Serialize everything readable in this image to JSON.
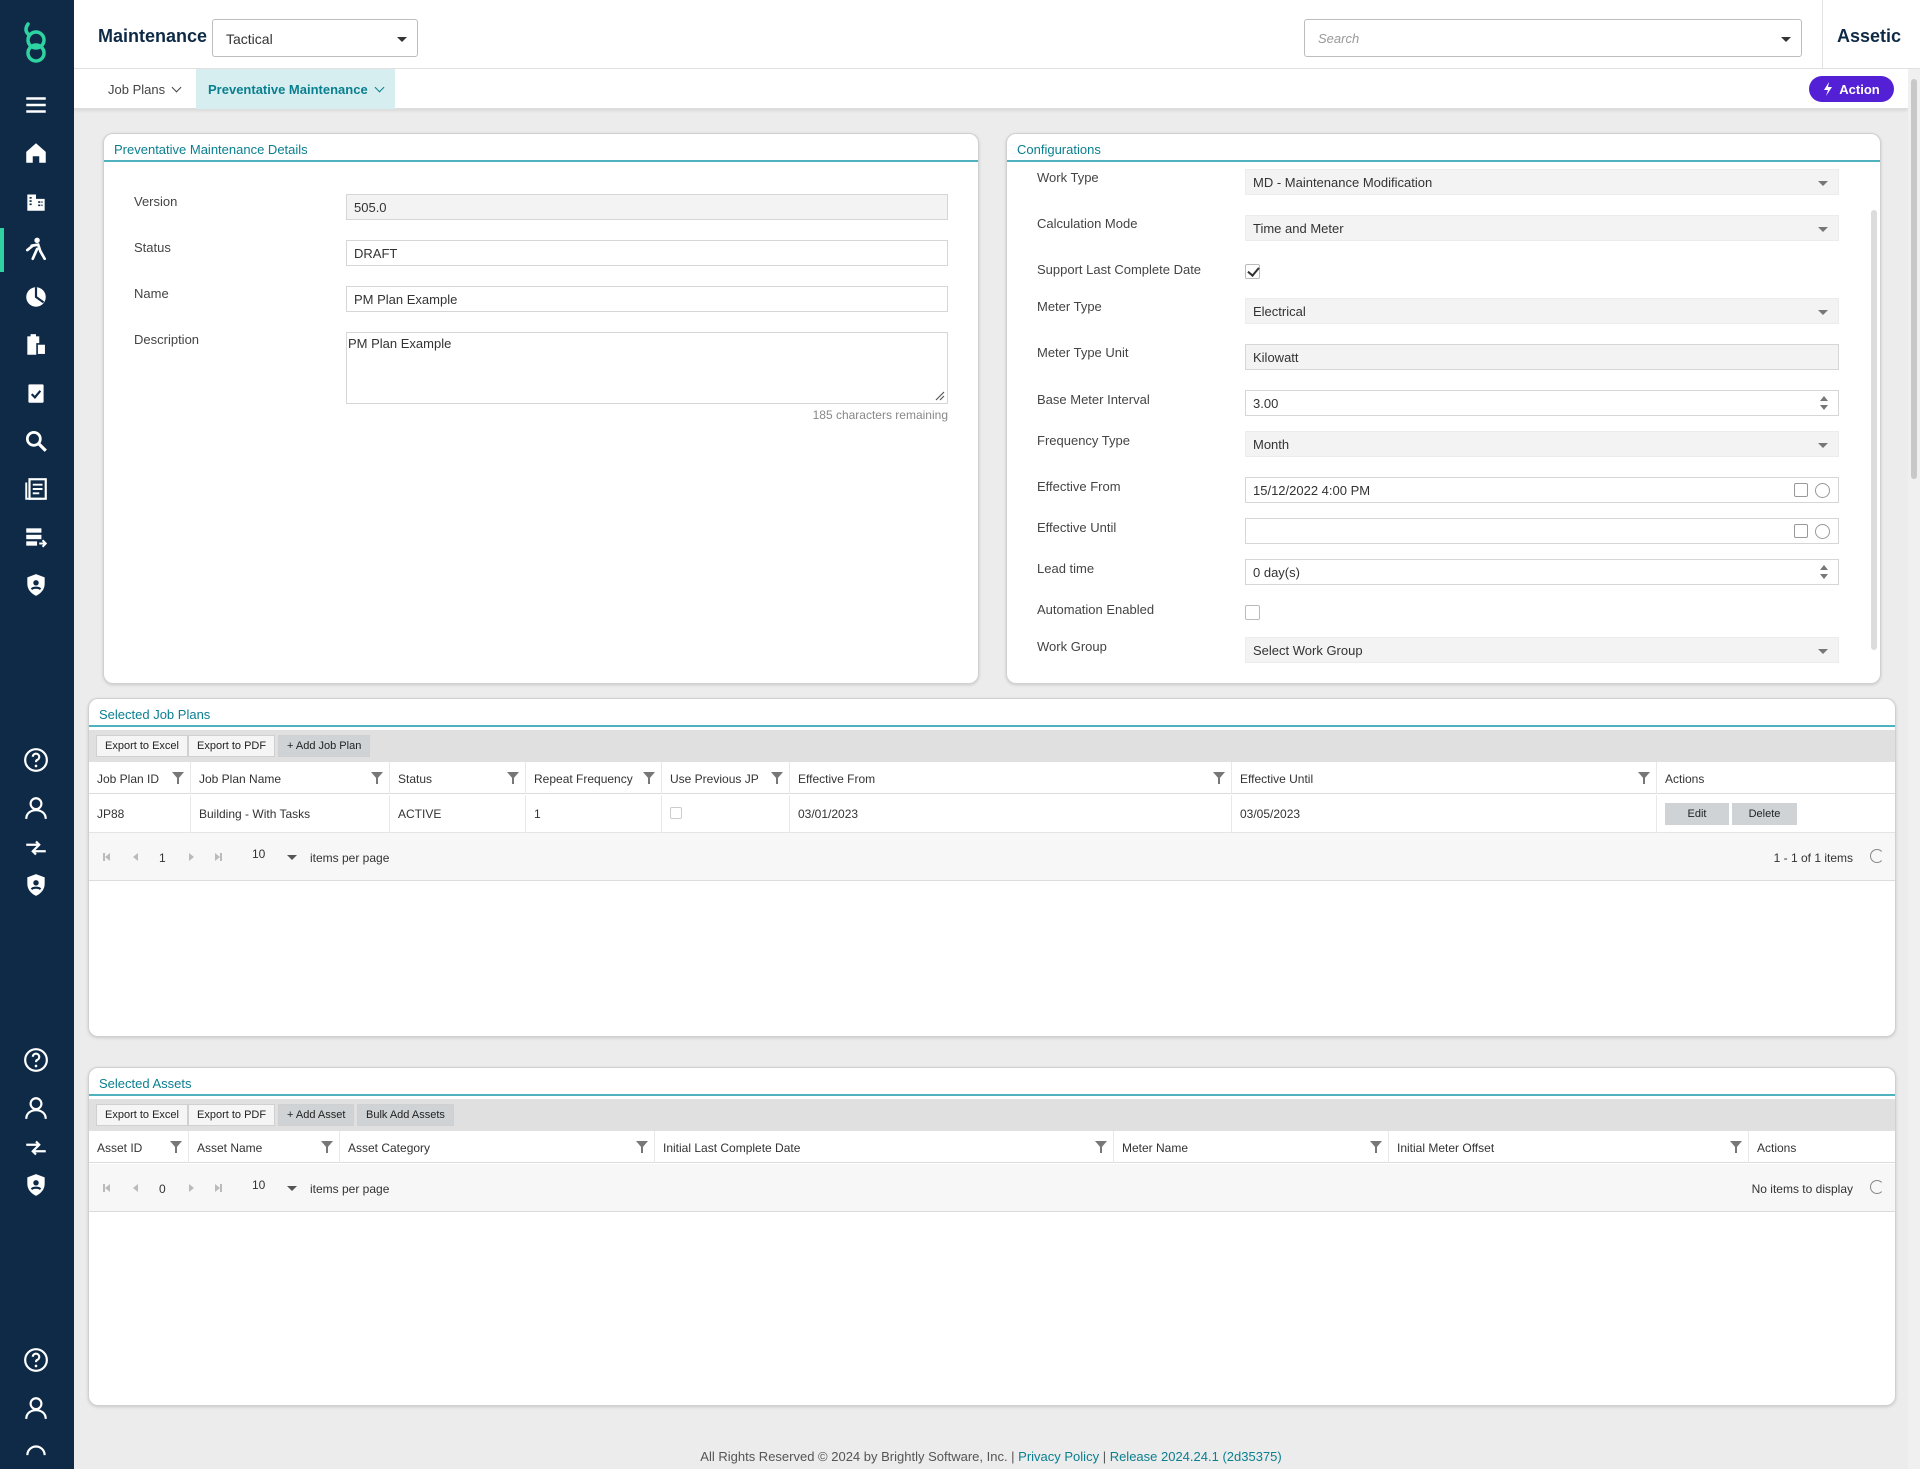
{
  "topbar": {
    "module_title": "Maintenance",
    "context_select": "Tactical",
    "search_placeholder": "Search",
    "brand": "Assetic"
  },
  "subnav": {
    "tabs": [
      {
        "label": "Job Plans"
      },
      {
        "label": "Preventative Maintenance"
      }
    ],
    "action_label": "Action"
  },
  "details": {
    "title": "Preventative Maintenance Details",
    "version_label": "Version",
    "version_value": "505.0",
    "status_label": "Status",
    "status_value": "DRAFT",
    "name_label": "Name",
    "name_value": "PM Plan Example",
    "description_label": "Description",
    "description_value": "PM Plan Example",
    "chars_remaining": "185 characters remaining"
  },
  "config": {
    "title": "Configurations",
    "work_type_label": "Work Type",
    "work_type_value": "MD - Maintenance Modification",
    "calc_mode_label": "Calculation Mode",
    "calc_mode_value": "Time and Meter",
    "support_last_label": "Support Last Complete Date",
    "support_last_checked": true,
    "meter_type_label": "Meter Type",
    "meter_type_value": "Electrical",
    "meter_unit_label": "Meter Type Unit",
    "meter_unit_value": "Kilowatt",
    "base_interval_label": "Base Meter Interval",
    "base_interval_value": "3.00",
    "freq_type_label": "Frequency Type",
    "freq_type_value": "Month",
    "eff_from_label": "Effective From",
    "eff_from_value": "15/12/2022 4:00 PM",
    "eff_until_label": "Effective Until",
    "eff_until_value": "",
    "lead_time_label": "Lead time",
    "lead_time_value": "0 day(s)",
    "automation_label": "Automation Enabled",
    "automation_checked": false,
    "work_group_label": "Work Group",
    "work_group_value": "Select Work Group"
  },
  "job_plans": {
    "title": "Selected Job Plans",
    "toolbar": [
      "Export to Excel",
      "Export to PDF",
      "+ Add Job Plan"
    ],
    "columns": [
      "Job Plan ID",
      "Job Plan Name",
      "Status",
      "Repeat Frequency",
      "Use Previous JP",
      "Effective From",
      "Effective Until",
      "Actions"
    ],
    "rows": [
      {
        "id": "JP88",
        "name": "Building - With Tasks",
        "status": "ACTIVE",
        "repeat": "1",
        "use_prev": false,
        "from": "03/01/2023",
        "until": "03/05/2023",
        "edit": "Edit",
        "delete": "Delete"
      }
    ],
    "pager": {
      "page": "1",
      "per_page": "10",
      "per_page_label": "items per page",
      "summary": "1 - 1 of 1 items"
    }
  },
  "assets": {
    "title": "Selected Assets",
    "toolbar": [
      "Export to Excel",
      "Export to PDF",
      "+ Add Asset",
      "Bulk Add Assets"
    ],
    "columns": [
      "Asset ID",
      "Asset Name",
      "Asset Category",
      "Initial Last Complete Date",
      "Meter Name",
      "Initial Meter Offset",
      "Actions"
    ],
    "pager": {
      "page": "0",
      "per_page": "10",
      "per_page_label": "items per page",
      "summary": "No items to display"
    }
  },
  "footer": {
    "text": "All Rights Reserved © 2024 by Brightly Software, Inc. | ",
    "privacy": "Privacy Policy",
    "sep": " | ",
    "release": "Release 2024.24.1 (2d35375)"
  },
  "colors": {
    "rail": "#0e2a47",
    "accent": "#2ed3a1",
    "teal": "#0a7f8f",
    "action": "#5320d6"
  },
  "icons": [
    "brightly-logo-icon",
    "menu-icon",
    "home-icon",
    "buildings-icon",
    "maintenance-worker-icon",
    "finance-icon",
    "clipboard-icon",
    "checklist-icon",
    "search-icon",
    "documents-icon",
    "data-transfer-icon",
    "shield-icon",
    "help-icon",
    "user-icon",
    "arrows-icon",
    "shield-icon"
  ]
}
